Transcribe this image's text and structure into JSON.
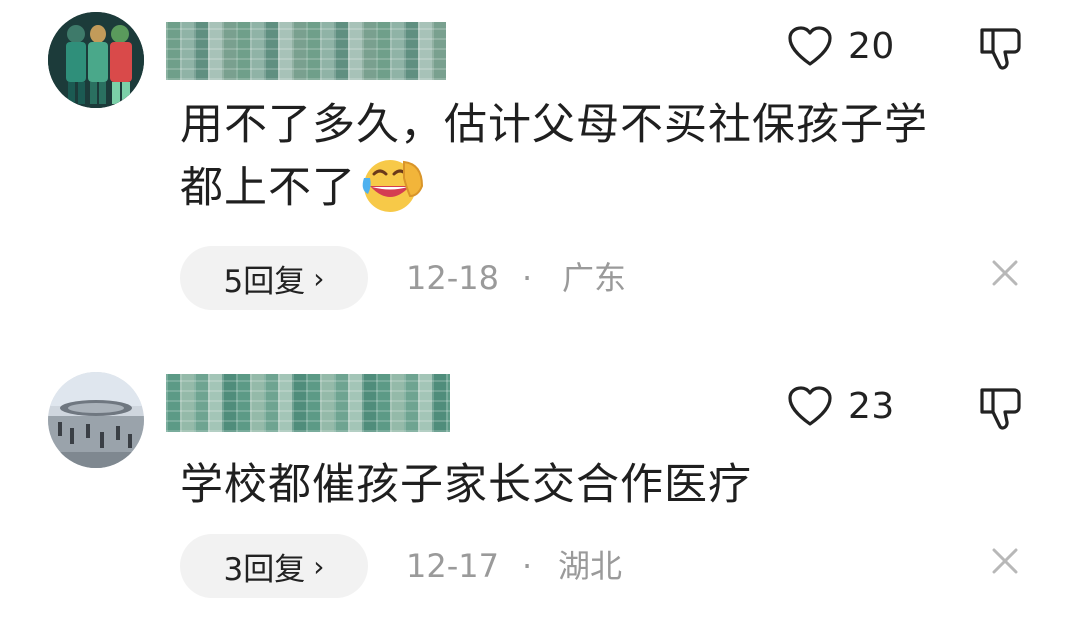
{
  "comments": [
    {
      "avatar_icon": "avatar-group-of-people-icon",
      "username": "",
      "like_icon": "heart-outline-icon",
      "like_count": "20",
      "dislike_icon": "thumbs-down-outline-icon",
      "text_line1": "用不了多久，估计父母不买社保孩子学",
      "text_line2": "都上不了",
      "emoji_icon": "laughing-with-tears-emoji-icon",
      "reply_label": "5回复",
      "reply_chevron": "›",
      "date": "12-18",
      "separator": "·",
      "location": "广东",
      "close_icon": "close-x-icon"
    },
    {
      "avatar_icon": "avatar-landscape-photo-icon",
      "username": "",
      "like_icon": "heart-outline-icon",
      "like_count": "23",
      "dislike_icon": "thumbs-down-outline-icon",
      "text_line1": "学校都催孩子家长交合作医疗",
      "reply_label": "3回复",
      "reply_chevron": "›",
      "date": "12-17",
      "separator": "·",
      "location": "湖北",
      "close_icon": "close-x-icon"
    }
  ],
  "colors": {
    "text_primary": "#1f1f1f",
    "text_secondary": "#9a9a9a",
    "pill_background": "#f2f2f2",
    "background": "#ffffff"
  }
}
